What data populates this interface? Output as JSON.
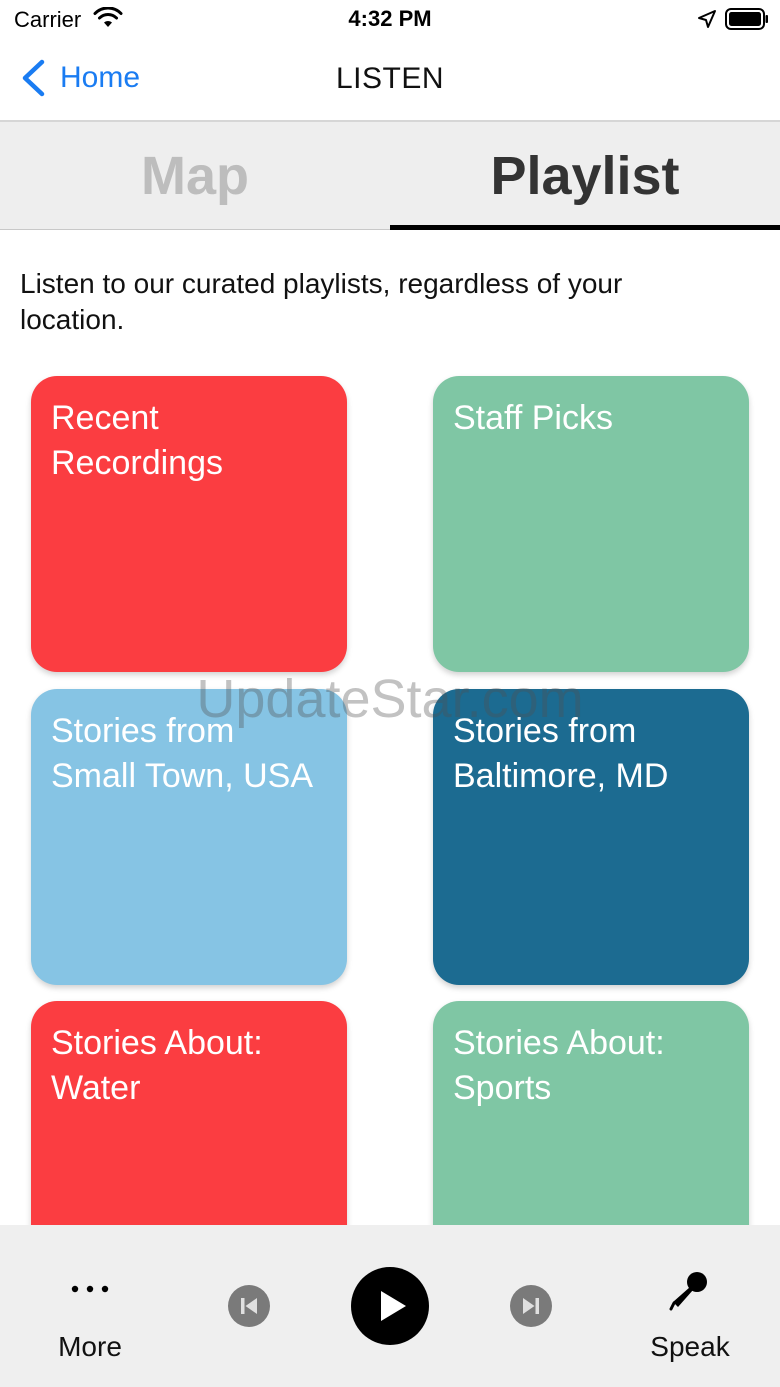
{
  "status_bar": {
    "carrier": "Carrier",
    "time": "4:32 PM",
    "icons": [
      "wifi-icon",
      "location-icon",
      "battery-icon"
    ]
  },
  "nav": {
    "back_label": "Home",
    "title": "LISTEN"
  },
  "tabs": [
    {
      "label": "Map",
      "selected": false
    },
    {
      "label": "Playlist",
      "selected": true
    }
  ],
  "intro_text": "Listen to our curated playlists, regardless of your location.",
  "playlists": [
    {
      "title": "Recent Recordings",
      "color": "#fb3d41"
    },
    {
      "title": "Staff Picks",
      "color": "#7fc6a4"
    },
    {
      "title": "Stories from Small Town, USA",
      "color": "#86c4e4"
    },
    {
      "title": "Stories from Baltimore, MD",
      "color": "#1c6b91"
    },
    {
      "title": "Stories About: Water",
      "color": "#fb3d41"
    },
    {
      "title": "Stories About: Sports",
      "color": "#7fc6a4"
    }
  ],
  "watermark": "UpdateStar.com",
  "player": {
    "more_label": "More",
    "speak_label": "Speak",
    "icons": [
      "more-icon",
      "previous-icon",
      "play-icon",
      "next-icon",
      "microphone-icon"
    ]
  },
  "colors": {
    "accent_blue": "#1a7cf2",
    "red": "#fb3d41",
    "green": "#7fc6a4",
    "light_blue": "#86c4e4",
    "dark_blue": "#1c6b91"
  }
}
